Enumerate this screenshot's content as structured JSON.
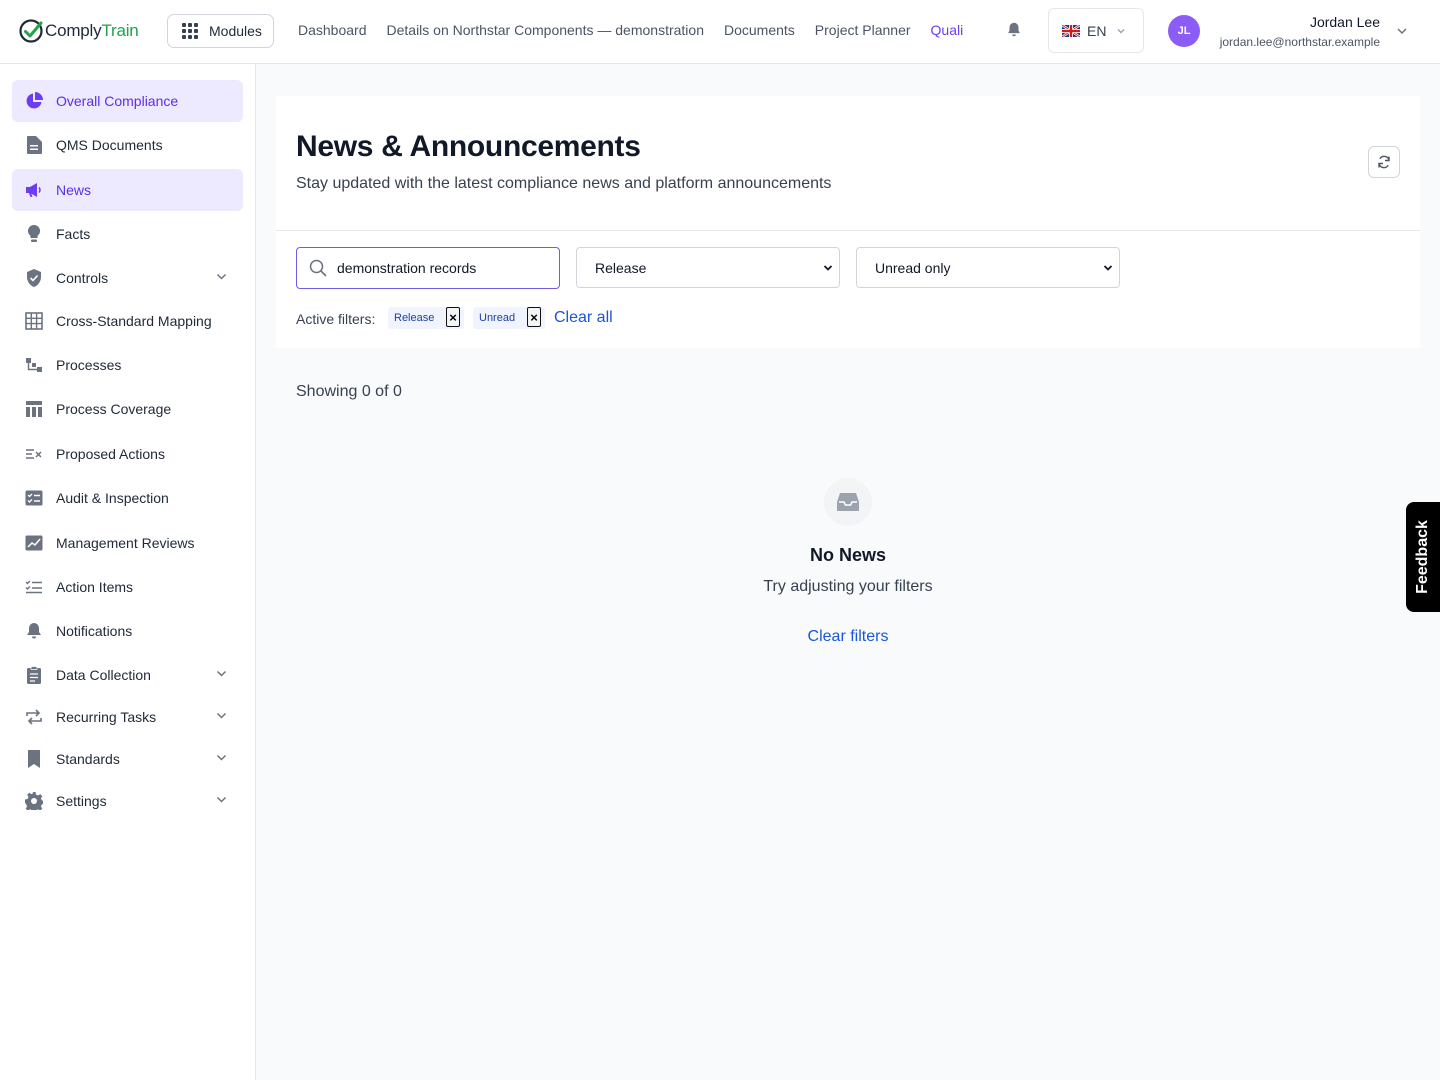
{
  "brand": {
    "name_part1": "Comply",
    "name_part2": "Train",
    "accent": "#22a34a"
  },
  "header": {
    "modules_label": "Modules",
    "nav": [
      "Dashboard",
      "Details on Northstar Components — demonstration",
      "Documents",
      "Project Planner",
      "Quali"
    ],
    "language": "EN",
    "user": {
      "initials": "JL",
      "name": "Jordan Lee",
      "email": "jordan.lee@northstar.example"
    }
  },
  "sidebar": {
    "items": [
      {
        "label": "Overall Compliance",
        "icon": "pie-chart-icon"
      },
      {
        "label": "QMS Documents",
        "icon": "document-icon"
      },
      {
        "label": "News",
        "icon": "megaphone-icon"
      },
      {
        "label": "Facts",
        "icon": "lightbulb-icon"
      },
      {
        "label": "Controls",
        "icon": "shield-icon"
      },
      {
        "label": "Cross-Standard Mapping",
        "icon": "table-icon"
      },
      {
        "label": "Processes",
        "icon": "flow-icon"
      },
      {
        "label": "Process Coverage",
        "icon": "layout-icon"
      },
      {
        "label": "Proposed Actions",
        "icon": "list-x-icon"
      },
      {
        "label": "Audit & Inspection",
        "icon": "checklist-icon"
      },
      {
        "label": "Management Reviews",
        "icon": "chart-edit-icon"
      },
      {
        "label": "Action Items",
        "icon": "list-check-icon"
      },
      {
        "label": "Notifications",
        "icon": "bell-icon"
      },
      {
        "label": "Data Collection",
        "icon": "clipboard-icon"
      },
      {
        "label": "Recurring Tasks",
        "icon": "repeat-icon"
      },
      {
        "label": "Standards",
        "icon": "bookmark-icon"
      },
      {
        "label": "Settings",
        "icon": "gear-icon"
      }
    ]
  },
  "page": {
    "title": "News & Announcements",
    "subtitle": "Stay updated with the latest compliance news and platform announcements"
  },
  "filters": {
    "search_value": "demonstration records",
    "type_selected": "Release",
    "status_selected": "Unread only",
    "active_label": "Active filters:",
    "chips": [
      "Release",
      "Unread"
    ],
    "chip_remove": "×",
    "clear_all": "Clear all"
  },
  "results": {
    "showing": "Showing 0 of 0",
    "empty_title": "No News",
    "empty_subtitle": "Try adjusting your filters",
    "clear_filters": "Clear filters"
  },
  "feedback": "Feedback",
  "colors": {
    "primary": "#6d3df5",
    "highlight_bg": "#ede9fe",
    "link": "#1a56db"
  }
}
